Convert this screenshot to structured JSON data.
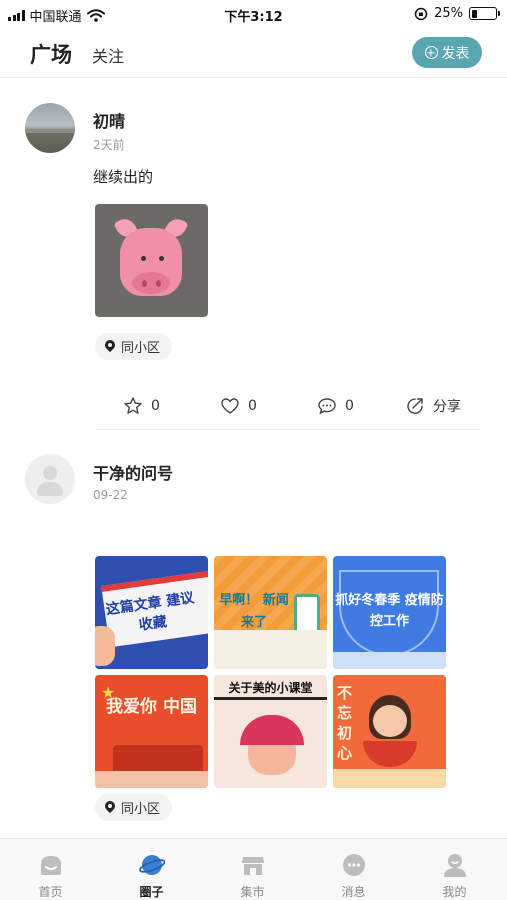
{
  "status_bar": {
    "carrier": "中国联通",
    "time": "下午3:12",
    "battery": "25%",
    "battery_level": 0.25
  },
  "header": {
    "tab_square": "广场",
    "tab_follow": "关注",
    "publish_label": "发表"
  },
  "posts": [
    {
      "username": "初晴",
      "time": "2天前",
      "text": "继续出的",
      "location": "同小区",
      "actions": {
        "favorite_count": "0",
        "like_count": "0",
        "comment_count": "0",
        "share_label": "分享"
      }
    },
    {
      "username": "干净的问号",
      "time": "09-22",
      "location": "同小区",
      "images": [
        {
          "caption": "这篇文章 建议收藏"
        },
        {
          "caption": "早啊！ 新闻来了"
        },
        {
          "caption": "抓好冬春季 疫情防控工作"
        },
        {
          "caption": "我爱你 中国"
        },
        {
          "caption": "关于美的小课堂"
        },
        {
          "caption": "不忘 初心"
        }
      ]
    }
  ],
  "bottom_nav": [
    {
      "label": "首页",
      "icon": "home-icon"
    },
    {
      "label": "圈子",
      "icon": "planet-icon",
      "active": true
    },
    {
      "label": "集市",
      "icon": "store-icon"
    },
    {
      "label": "消息",
      "icon": "message-icon"
    },
    {
      "label": "我的",
      "icon": "profile-icon"
    }
  ],
  "colors": {
    "accent": "#5aa6b0",
    "active_nav": "#3a7fd5"
  }
}
